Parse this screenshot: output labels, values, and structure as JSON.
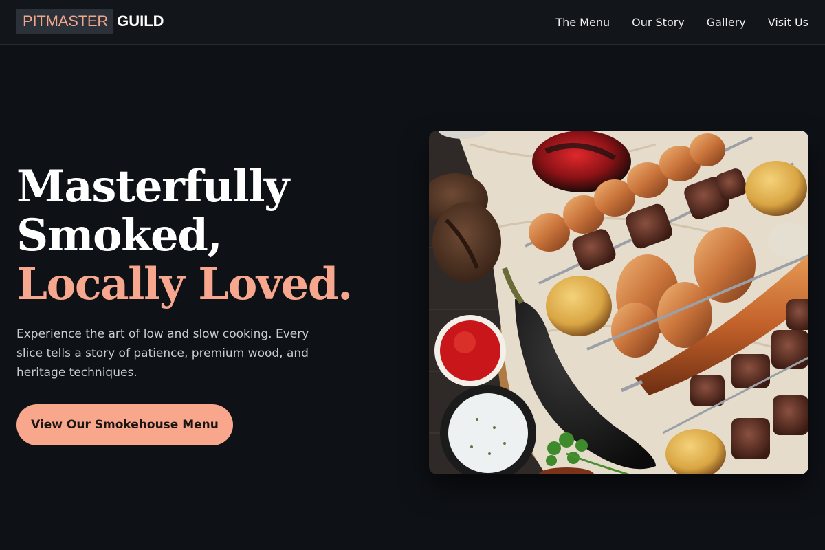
{
  "brand": {
    "mark": "PITMASTER",
    "word": "GUILD"
  },
  "nav": {
    "items": [
      "The Menu",
      "Our Story",
      "Gallery",
      "Visit Us"
    ]
  },
  "hero": {
    "headline_line1": "Masterfully",
    "headline_line2": "Smoked,",
    "headline_accent": "Locally Loved.",
    "intro": "Experience the art of low and slow cooking. Every slice tells a story of patience, premium wood, and heritage techniques.",
    "cta_label": "View Our Smokehouse Menu"
  },
  "image": {
    "alt": "Platter of grilled kebabs, roasted vegetables and dips"
  },
  "colors": {
    "background": "#0e1116",
    "header": "#12161a",
    "accent": "#f6a78d",
    "logo_badge": "#2b3138"
  }
}
